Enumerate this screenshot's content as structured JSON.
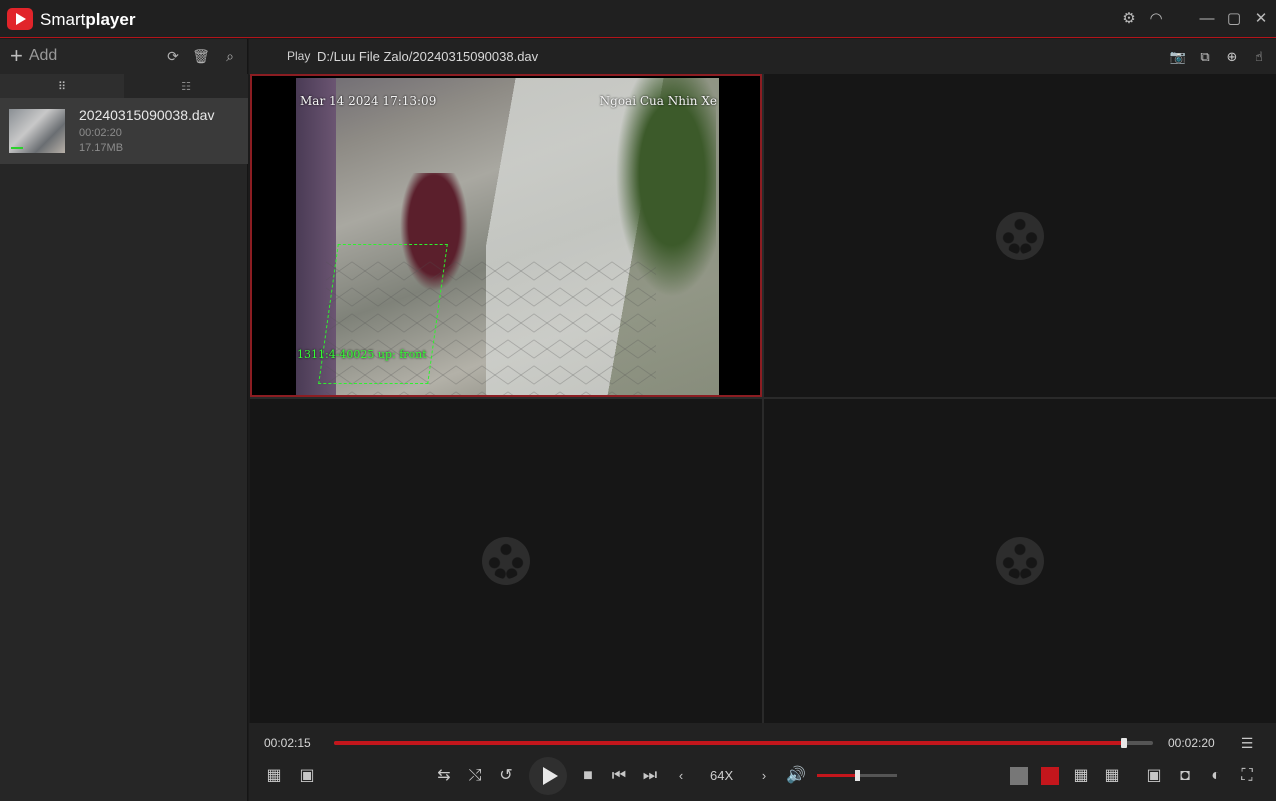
{
  "app": {
    "title_light": "Smart",
    "title_bold": "player"
  },
  "titlebar": {
    "icons": [
      "settings-icon",
      "headset-icon",
      "minimize-icon",
      "maximize-icon",
      "close-icon"
    ],
    "icon_glyphs": [
      "⚙",
      "◠",
      "—",
      "▢",
      "✕"
    ]
  },
  "sidebar": {
    "add_label": "Add",
    "icons": [
      "refresh-icon",
      "trash-icon",
      "search-icon"
    ],
    "icon_glyphs": [
      "⟳",
      "🗑",
      "⌕"
    ],
    "tabs": [
      {
        "glyph": "⠿",
        "name": "thumbnail-view"
      },
      {
        "glyph": "☷",
        "name": "list-view"
      }
    ],
    "files": [
      {
        "name": "20240315090038.dav",
        "duration": "00:02:20",
        "size": "17.17MB"
      }
    ]
  },
  "pathbar": {
    "play_label": "Play",
    "path": "D:/Luu File Zalo/20240315090038.dav",
    "icons": [
      "snapshot-icon",
      "multi-snapshot-icon",
      "zoom-icon",
      "hand-icon"
    ],
    "icon_glyphs": [
      "📷",
      "⧉",
      "⊕",
      "☝"
    ]
  },
  "video": {
    "osd_date": "Mar 14 2024 17:13:09",
    "osd_camera": "Ngoai Cua Nhin Xe",
    "osd_detection": "1311:4-40025 up: front"
  },
  "playback": {
    "current_time": "00:02:15",
    "total_time": "00:02:20",
    "progress": 0.964,
    "speed": "64X",
    "volume": 0.5
  },
  "colors": {
    "accent": "#c4161c",
    "selected_border": "#8c1d22"
  }
}
